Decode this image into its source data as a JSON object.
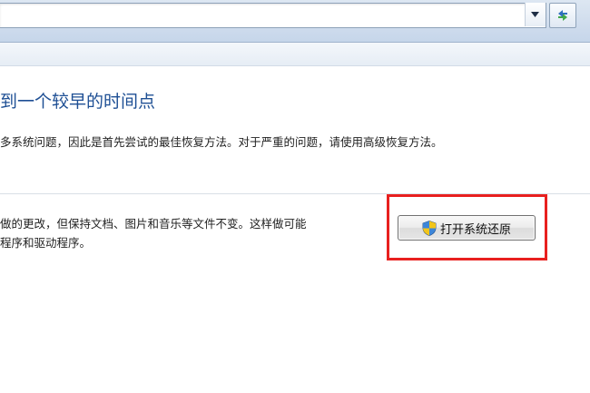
{
  "heading": "到一个较早的时间点",
  "description": "多系统问题，因此是首先尝试的最佳恢复方法。对于严重的问题，请使用高级恢复方法。",
  "restore_section": {
    "lines": [
      "做的更改，但保持文档、图片和音乐等文件不变。这样做可能",
      "程序和驱动程序。"
    ],
    "button_label": "打开系统还原",
    "button_icon": "uac-shield-icon"
  },
  "colors": {
    "heading": "#1e4f94",
    "highlight": "#e8201f"
  }
}
